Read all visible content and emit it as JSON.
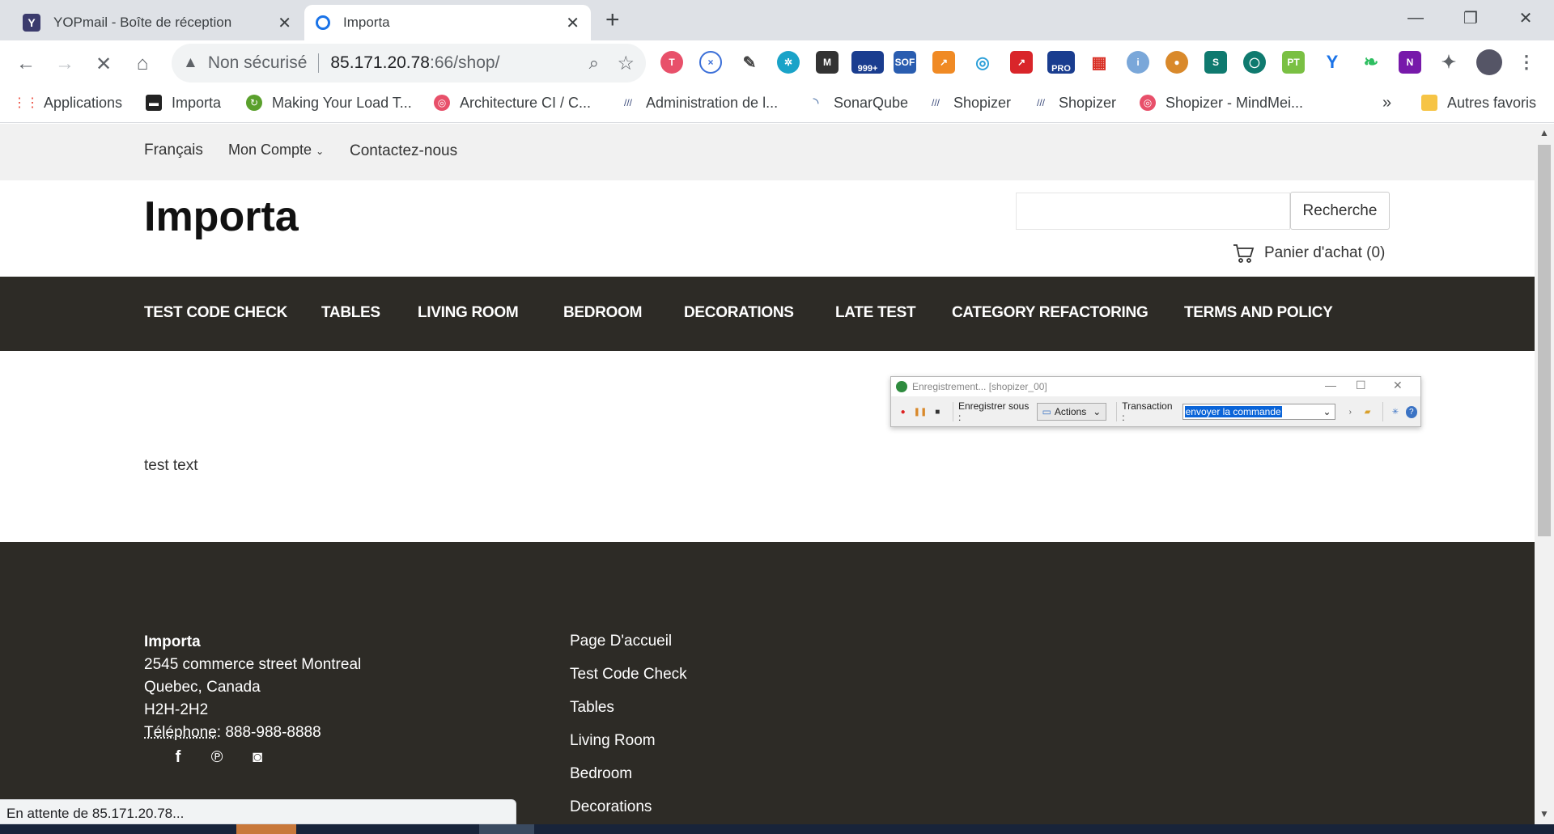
{
  "browser": {
    "tabs": [
      {
        "title": "YOPmail - Boîte de réception",
        "icon": "yopmail-icon"
      },
      {
        "title": "Importa",
        "icon": "loading-icon"
      }
    ],
    "new_tab": "+",
    "window_controls": {
      "minimize": "—",
      "restore": "❐",
      "close": "✕"
    },
    "nav": {
      "back": "←",
      "forward": "→",
      "stop": "✕",
      "home": "⌂"
    },
    "address": {
      "warning": "Non sécurisé",
      "host": "85.171.20.78",
      "path": ":66/shop/"
    },
    "bookmarks": [
      {
        "label": "Applications",
        "icon": "apps-grid-icon"
      },
      {
        "label": "Importa",
        "icon": "importa-icon"
      },
      {
        "label": "Making Your Load T...",
        "icon": "load-icon"
      },
      {
        "label": "Architecture CI / C...",
        "icon": "mindmeister-icon"
      },
      {
        "label": "Administration de l...",
        "icon": "shopizer-icon"
      },
      {
        "label": "SonarQube",
        "icon": "sonarqube-icon"
      },
      {
        "label": "Shopizer",
        "icon": "shopizer-icon"
      },
      {
        "label": "Shopizer",
        "icon": "shopizer-icon"
      },
      {
        "label": "Shopizer - MindMei...",
        "icon": "mindmeister-icon"
      }
    ],
    "bookmarks_more": "»",
    "other_bookmarks": "Autres favoris",
    "extension_badges": {
      "mail_count": "999+",
      "pro": "PRO",
      "sof": "SOF",
      "pt": "PT"
    },
    "status": "En attente de 85.171.20.78..."
  },
  "shop": {
    "topbar": {
      "language": "Français",
      "account": "Mon Compte",
      "contact": "Contactez-nous"
    },
    "brand": "Importa",
    "search_button": "Recherche",
    "cart": "Panier d'achat (0)",
    "categories": [
      "TEST CODE CHECK",
      "TABLES",
      "LIVING ROOM",
      "BEDROOM",
      "DECORATIONS",
      "LATE TEST",
      "CATEGORY REFACTORING",
      "TERMS AND POLICY"
    ],
    "content_text": "test text",
    "footer": {
      "company": "Importa",
      "address1": "2545 commerce street Montreal",
      "address2": "Quebec, Canada",
      "postal": "H2H-2H2",
      "phone_label": "Téléphone",
      "phone": ": 888-988-8888",
      "links": [
        "Page D'accueil",
        "Test Code Check",
        "Tables",
        "Living Room",
        "Bedroom",
        "Decorations"
      ]
    }
  },
  "recorder": {
    "title": "Enregistrement... [shopizer_00]",
    "save_as_label": "Enregistrer sous :",
    "save_as_value": "Actions",
    "transaction_label": "Transaction :",
    "transaction_value": "envoyer la commande"
  }
}
